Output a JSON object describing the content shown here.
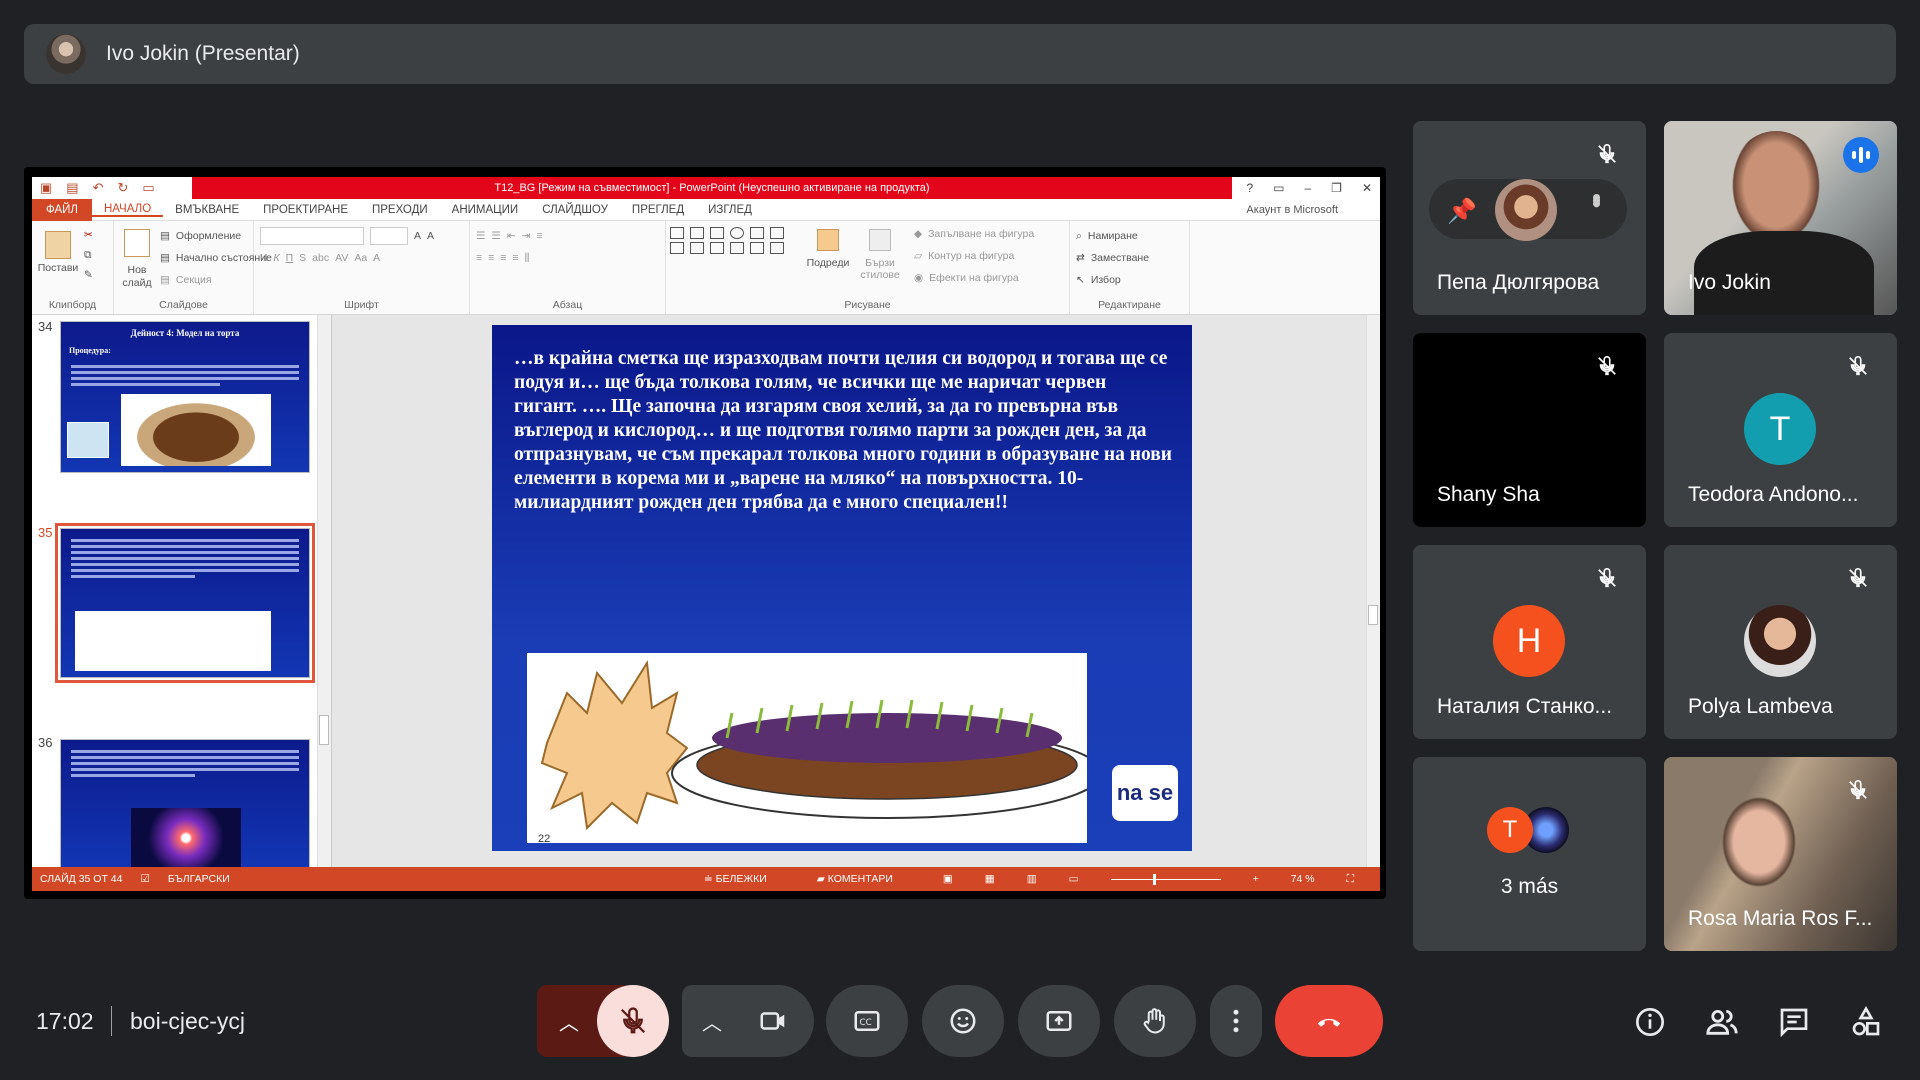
{
  "meeting": {
    "presenter_label": "Ivo Jokin (Presentar)",
    "time": "17:02",
    "code": "boi-cjec-ycj"
  },
  "ppt": {
    "title": "T12_BG [Режим на съвместимост] - PowerPoint (Неуспешно активиране на продукта)",
    "tabs": [
      "ФАЙЛ",
      "НАЧАЛО",
      "ВМЪКВАНЕ",
      "ПРОЕКТИРАНЕ",
      "ПРЕХОДИ",
      "АНИМАЦИИ",
      "СЛАЙДШОУ",
      "ПРЕГЛЕД",
      "ИЗГЛЕД"
    ],
    "account": "Акаунт в Microsoft",
    "groups": {
      "clipboard": {
        "label": "Клипборд",
        "paste": "Постави"
      },
      "slides": {
        "label": "Слайдове",
        "new": "Нов слайд",
        "layout": "Оформление",
        "reset": "Начално състояние",
        "section": "Секция"
      },
      "font": {
        "label": "Шрифт"
      },
      "paragraph": {
        "label": "Абзац"
      },
      "drawing": {
        "label": "Рисуване",
        "arrange": "Подреди",
        "quick": "Бързи стилове",
        "fill": "Запълване на фигура",
        "outline": "Контур на фигура",
        "effects": "Ефекти на фигура"
      },
      "editing": {
        "label": "Редактиране",
        "find": "Намиране",
        "replace": "Заместване",
        "select": "Избор"
      }
    },
    "thumbs": [
      {
        "num": "34",
        "title": "Дейност 4: Модел на торта",
        "sub": "Процедура:"
      },
      {
        "num": "35"
      },
      {
        "num": "36"
      }
    ],
    "slide_text": "…в крайна сметка ще изразходвам почти целия си водород и тогава ще се подуя и… ще бъда толкова голям, че всички ще ме наричат червен гигант. …. Ще започна да изгарям своя хелий, за да го превърна във въглерод и кислород… и ще подготвя голямо парти за рожден ден, за да отпразнувам, че съм прекарал толкова много години в образуване на нови елементи в корема ми и „варене на мляко“ на повърхността. 10-милиардният рожден ден трябва да е много специален!!",
    "slide_number": "22",
    "logo_text": "na se",
    "status": {
      "slide": "СЛАЙД 35 ОТ 44",
      "lang": "БЪЛГАРСКИ",
      "notes": "БЕЛЕЖКИ",
      "comments": "КОМЕНТАРИ",
      "zoom": "74 %"
    }
  },
  "participants": [
    {
      "name": "Пепа Дюлгярова"
    },
    {
      "name": "Ivo Jokin"
    },
    {
      "name": "Shany Sha"
    },
    {
      "name": "Teodora Andono...",
      "initial": "T",
      "color": "#129eaf"
    },
    {
      "name": "Наталия Станко...",
      "initial": "H",
      "color": "#f4511e"
    },
    {
      "name": "Polya Lambeva"
    },
    {
      "name": "3 más",
      "initial": "T",
      "color": "#f4511e"
    },
    {
      "name": "Rosa Maria Ros F..."
    }
  ],
  "colors": {
    "end_call": "#ea4335",
    "mic_off_bg": "#f9dedc",
    "mic_chevron_bg": "#5c1a14",
    "active_outline": "#8ab4f8"
  }
}
